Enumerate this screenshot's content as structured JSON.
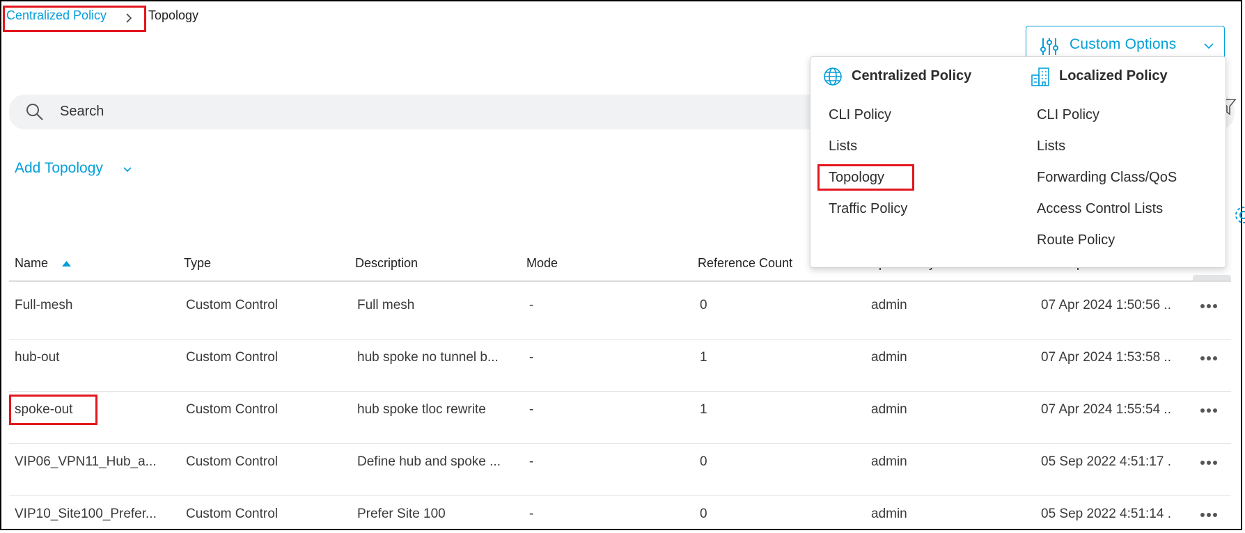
{
  "breadcrumb": {
    "parent": "Centralized Policy",
    "current": "Topology"
  },
  "custom_options": {
    "label": "Custom Options"
  },
  "search": {
    "placeholder": "Search"
  },
  "add_topology": {
    "label": "Add Topology"
  },
  "table": {
    "columns": [
      "Name",
      "Type",
      "Description",
      "Mode",
      "Reference Count",
      "Updated By",
      "Last Updated"
    ],
    "rows": [
      {
        "name": "Full-mesh",
        "type": "Custom Control",
        "description": "Full mesh",
        "mode": "-",
        "ref_count": "0",
        "updated_by": "admin",
        "last_updated": "07 Apr 2024 1:50:56 .."
      },
      {
        "name": "hub-out",
        "type": "Custom Control",
        "description": "hub spoke no tunnel b...",
        "mode": "-",
        "ref_count": "1",
        "updated_by": "admin",
        "last_updated": "07 Apr 2024 1:53:58 .."
      },
      {
        "name": "spoke-out",
        "type": "Custom Control",
        "description": "hub spoke tloc rewrite",
        "mode": "-",
        "ref_count": "1",
        "updated_by": "admin",
        "last_updated": "07 Apr 2024 1:55:54 .."
      },
      {
        "name": "VIP06_VPN11_Hub_a...",
        "type": "Custom Control",
        "description": "Define hub and spoke ...",
        "mode": "-",
        "ref_count": "0",
        "updated_by": "admin",
        "last_updated": "05 Sep 2022 4:51:17 ."
      },
      {
        "name": "VIP10_Site100_Prefer...",
        "type": "Custom Control",
        "description": "Prefer Site 100",
        "mode": "-",
        "ref_count": "0",
        "updated_by": "admin",
        "last_updated": "05 Sep 2022 4:51:14 ."
      }
    ]
  },
  "dropdown": {
    "centralized": {
      "title": "Centralized Policy",
      "items": [
        "CLI Policy",
        "Lists",
        "Topology",
        "Traffic Policy"
      ]
    },
    "localized": {
      "title": "Localized Policy",
      "items": [
        "CLI Policy",
        "Lists",
        "Forwarding Class/QoS",
        "Access Control Lists",
        "Route Policy"
      ]
    }
  },
  "colors": {
    "accent": "#049fd9",
    "annotation": "#e3161e"
  },
  "icons": [
    "chevron-right-icon",
    "sliders-icon",
    "chevron-down-icon",
    "search-icon",
    "filter-icon",
    "gear-icon",
    "sort-asc-icon",
    "more-icon",
    "globe-icon",
    "building-icon"
  ]
}
